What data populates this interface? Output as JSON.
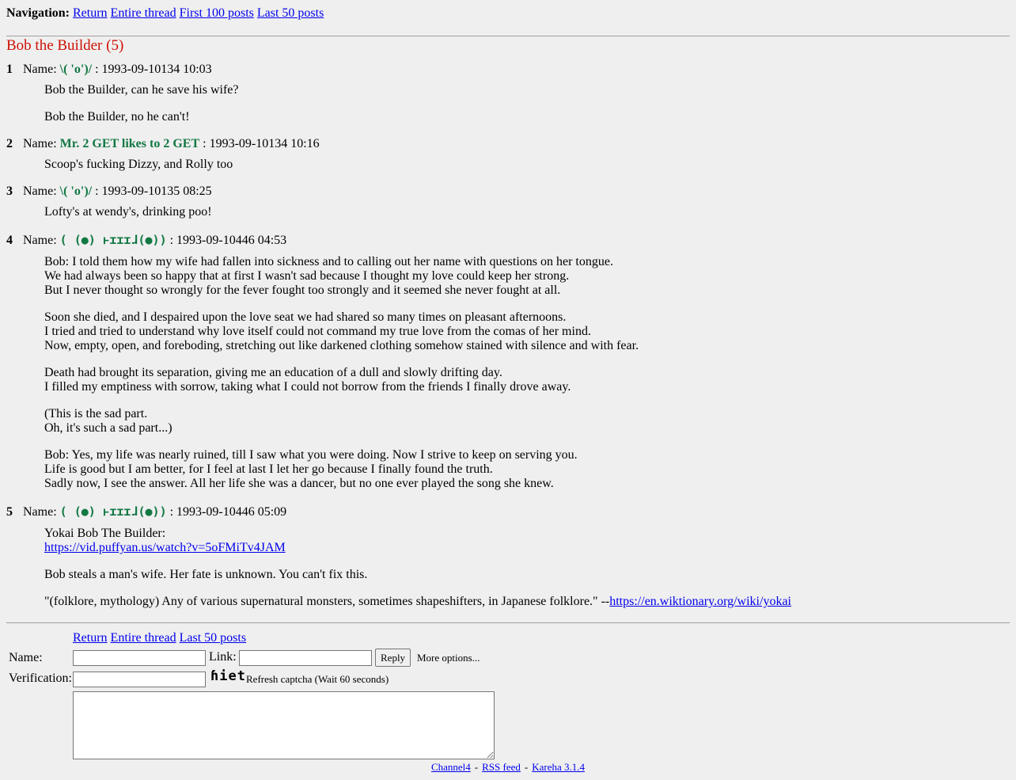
{
  "navigation": {
    "label": "Navigation:",
    "links": [
      "Return",
      "Entire thread",
      "First 100 posts",
      "Last 50 posts"
    ]
  },
  "thread": {
    "title": "Bob the Builder (5)"
  },
  "posts": [
    {
      "num": "1",
      "name_label": "Name:",
      "poster": "\\( 'o')/",
      "date": ": 1993-09-10134 10:03",
      "paragraphs": [
        [
          "Bob the Builder, can he save his wife?"
        ],
        [
          "Bob the Builder, no he can't!"
        ]
      ]
    },
    {
      "num": "2",
      "name_label": "Name:",
      "poster": "Mr. 2 GET likes to 2 GET",
      "date": ": 1993-09-10134 10:16",
      "paragraphs": [
        [
          "Scoop's fucking Dizzy, and Rolly too"
        ]
      ]
    },
    {
      "num": "3",
      "name_label": "Name:",
      "poster": "\\( 'o')/",
      "date": ": 1993-09-10135 08:25",
      "paragraphs": [
        [
          "Lofty's at wendy's, drinking poo!"
        ]
      ]
    },
    {
      "num": "4",
      "name_label": "Name:",
      "poster": "( (●) ͱɪɪɪɺ(●))",
      "date": ": 1993-09-10446 04:53",
      "paragraphs": [
        [
          "Bob: I told them how my wife had fallen into sickness and to calling out her name with questions on her tongue.",
          "We had always been so happy that at first I wasn't sad because I thought my love could keep her strong.",
          "But I never thought so wrongly for the fever fought too strongly and it seemed she never fought at all."
        ],
        [
          "Soon she died, and I despaired upon the love seat we had shared so many times on pleasant afternoons.",
          "I tried and tried to understand why love itself could not command my true love from the comas of her mind.",
          "Now, empty, open, and foreboding, stretching out like darkened clothing somehow stained with silence and with fear."
        ],
        [
          "Death had brought its separation, giving me an education of a dull and slowly drifting day.",
          "I filled my emptiness with sorrow, taking what I could not borrow from the friends I finally drove away."
        ],
        [
          "(This is the sad part.",
          "Oh, it's such a sad part...)"
        ],
        [
          "Bob: Yes, my life was nearly ruined, till I saw what you were doing. Now I strive to keep on serving you.",
          "Life is good but I am better, for I feel at last I let her go because I finally found the truth.",
          "Sadly now, I see the answer. All her life she was a dancer, but no one ever played the song she knew."
        ]
      ]
    },
    {
      "num": "5",
      "name_label": "Name:",
      "poster": "( (●) ͱɪɪɪɺ(●))",
      "date": ": 1993-09-10446 05:09",
      "p1_line1": "Yokai Bob The Builder:",
      "p1_link": "https://vid.puffyan.us/watch?v=5oFMiTv4JAM",
      "p2": "Bob steals a man's wife. Her fate is unknown. You can't fix this.",
      "p3_text": "\"(folklore, mythology) Any of various supernatural monsters, sometimes shapeshifters, in Japanese folklore.\" --",
      "p3_link": "https://en.wiktionary.org/wiki/yokai"
    }
  ],
  "reply_form": {
    "links": [
      "Return",
      "Entire thread",
      "Last 50 posts"
    ],
    "name_label": "Name:",
    "link_label": "Link:",
    "reply_button": "Reply",
    "more_options": "More options...",
    "verification_label": "Verification:",
    "captcha_text": "ɦiet",
    "refresh_captcha": "Refresh captcha (Wait 60 seconds)",
    "name_value": "",
    "link_value": "",
    "verification_value": "",
    "comment_value": ""
  },
  "footer": {
    "links": [
      "Channel4",
      "RSS feed",
      "Kareha 3.1.4"
    ],
    "separator": "-"
  }
}
